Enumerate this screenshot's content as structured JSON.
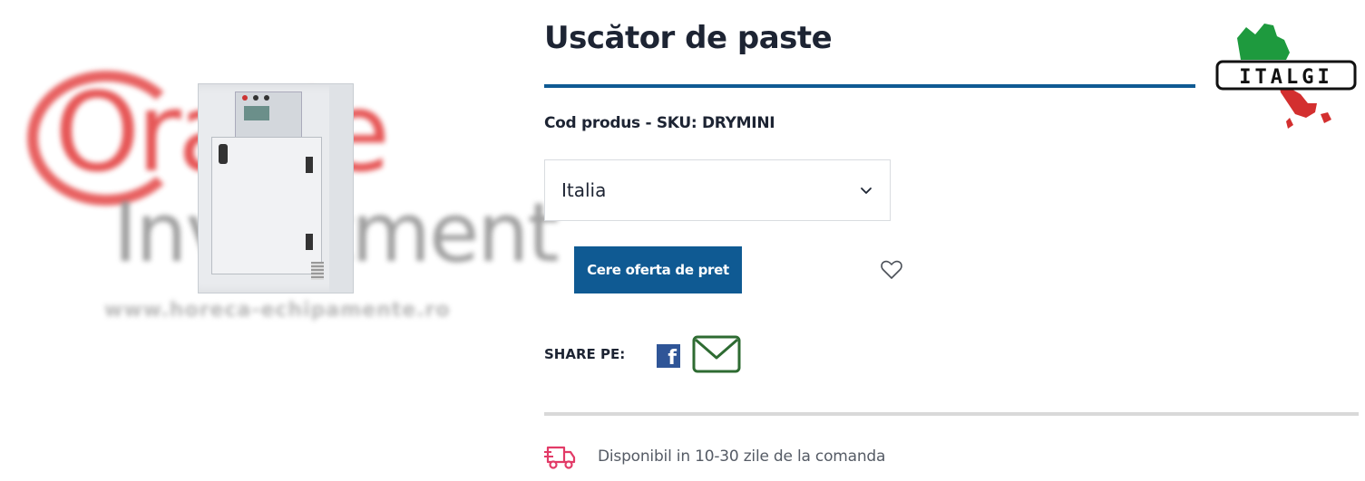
{
  "product": {
    "title": "Uscător de paste",
    "sku": "Cod produs - SKU: DRYMINI"
  },
  "watermark": {
    "line1": "Oracle",
    "line2": "Investment",
    "url": "www.horeca-echipamente.ro"
  },
  "country_select": {
    "value": "Italia"
  },
  "actions": {
    "quote_label": "Cere oferta de pret"
  },
  "share": {
    "label": "SHARE PE:"
  },
  "availability": {
    "text": "Disponibil in 10-30 zile de la comanda"
  },
  "brand": {
    "name": "ITALGI"
  },
  "colors": {
    "primary": "#0f5a93",
    "text": "#1d2433",
    "facebook": "#2f5597",
    "mail": "#2e6b32",
    "truck": "#e23b67"
  },
  "icons": {
    "chevron": "chevron-down-icon",
    "wishlist": "heart-icon",
    "facebook": "facebook-icon",
    "mail": "mail-icon",
    "truck": "truck-icon"
  }
}
